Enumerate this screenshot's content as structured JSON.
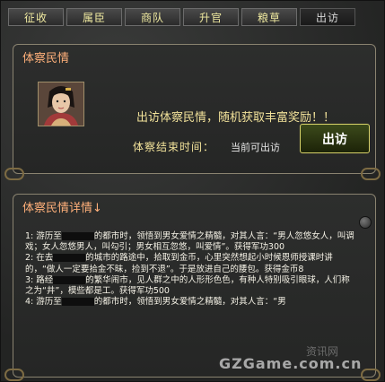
{
  "tabs": [
    {
      "label": "征收"
    },
    {
      "label": "属臣"
    },
    {
      "label": "商队"
    },
    {
      "label": "升官"
    },
    {
      "label": "粮草"
    },
    {
      "label": "出访"
    }
  ],
  "inspect_panel": {
    "title": "体察民情",
    "promo_text": "出访体察民情，随机获取丰富奖励！！",
    "end_time_label": "体察结束时间：",
    "end_time_value": "当前可出访",
    "visit_button": "出访"
  },
  "details_panel": {
    "title": "体察民情详情↓",
    "entries": [
      {
        "prefix": "1:  游历至",
        "text": "的都市时，领悟到男女爱情之精髓，对其人言：“男人忽悠女人，叫调戏；女人忽悠男人，叫勾引；男女相互忽悠，叫爱情”。获得军功300"
      },
      {
        "prefix": "2:  在去",
        "text": "的城市的路途中，拾取到金币，心里突然想起小时候恩师授课时讲的，“做人一定要拾金不昧，捡到不退”。于是放进自己的腰包。获得金币8"
      },
      {
        "prefix": "3:  路经",
        "text": "的繁华闹市，见人群之中的人形形色色，有种人特别吸引眼球，人们称之为“井”，模些都是工。获得军功500"
      },
      {
        "prefix": "4:  游历至",
        "text": "的都市时，领悟到男女爱情之精髓，对其人言：“男"
      }
    ]
  },
  "watermark": {
    "line1": "资讯网",
    "line2": "GZGame.com.cn"
  }
}
